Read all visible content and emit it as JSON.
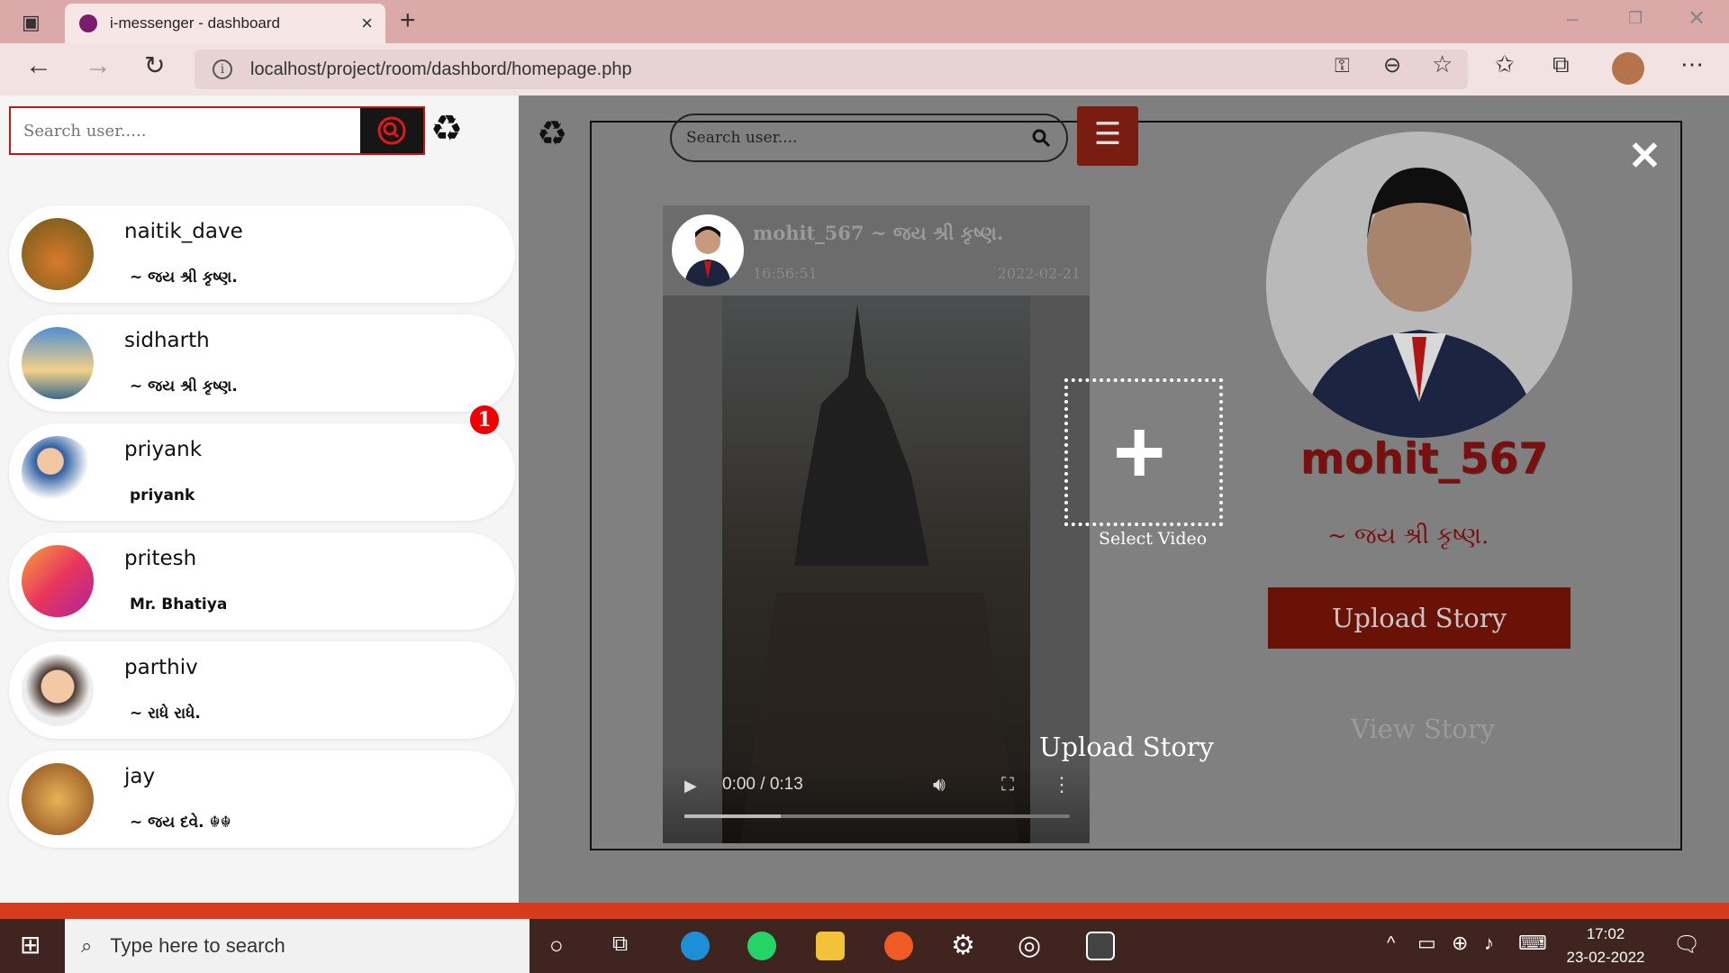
{
  "browser": {
    "tab_title": "i-messenger - dashboard",
    "url": "localhost/project/room/dashbord/homepage.php"
  },
  "sidebar": {
    "search_placeholder": "Search user.....",
    "users": [
      {
        "name": "naitik_dave",
        "status": "~ જય શ્રી કૃષ્ણ.",
        "avatar_color": "#8a6b2a"
      },
      {
        "name": "sidharth",
        "status": "~ જય શ્રી કૃષ્ણ.",
        "avatar_color": "#5b9fd6"
      },
      {
        "name": "priyank",
        "status": "priyank",
        "avatar_color": "#2b4f86",
        "badge": "1"
      },
      {
        "name": "pritesh",
        "status": "Mr. Bhatiya",
        "avatar_color": "#e8365d"
      },
      {
        "name": "parthiv",
        "status": "~ રાધે રાધે.",
        "avatar_color": "#c5a27c"
      },
      {
        "name": "jay",
        "status": "~ જય દવે. ☬☬",
        "avatar_color": "#b07a2a"
      }
    ]
  },
  "main": {
    "search_placeholder": "Search user....",
    "post": {
      "author": "mohit_567 ~ જય શ્રી કૃષ્ણ.",
      "time": "16:56:51",
      "date": "2022-02-21",
      "video_time": "0:00 / 0:13",
      "video_progress": 0.25
    }
  },
  "modal": {
    "select_label": "Select Video",
    "upload_story_label": "Upload Story",
    "profile_name": "mohit_567",
    "profile_status": "~ જય શ્રી કૃષ્ણ.",
    "upload_button": "Upload Story",
    "view_story": "View Story"
  },
  "taskbar": {
    "search_placeholder": "Type here to search",
    "time": "17:02",
    "date": "23-02-2022"
  },
  "colors": {
    "accent": "#c01717",
    "brand_dark": "#7a1d10"
  }
}
